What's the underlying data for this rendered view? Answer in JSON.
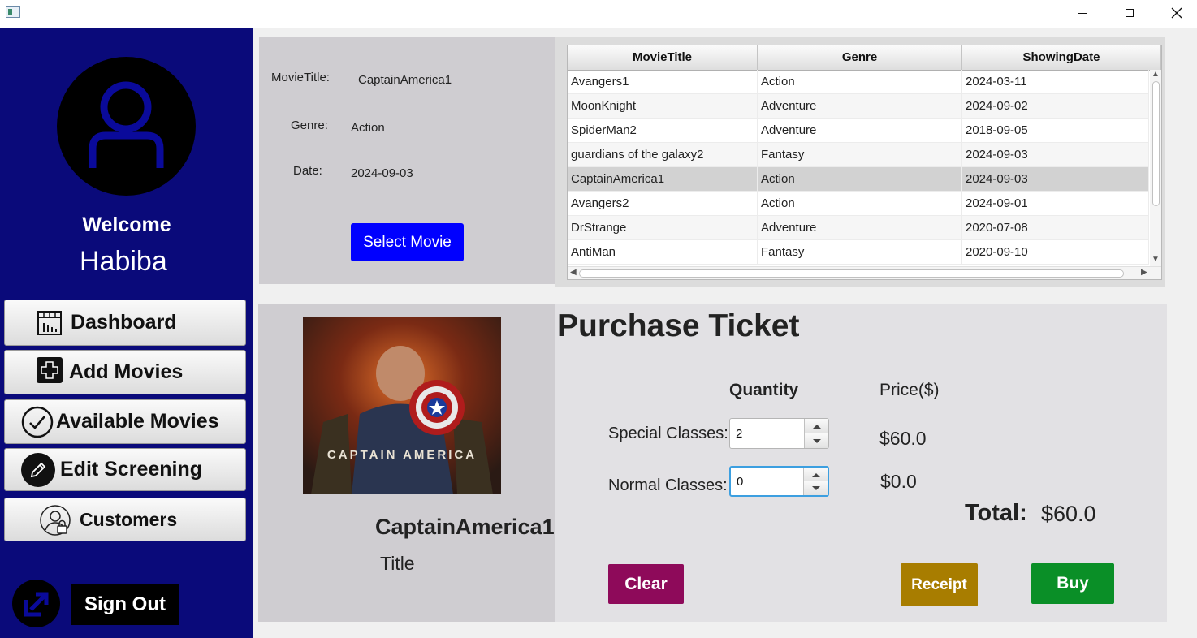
{
  "window": {
    "controls": {
      "minimize": "minimize",
      "maximize": "maximize",
      "close": "close"
    }
  },
  "sidebar": {
    "welcome": "Welcome",
    "username": "Habiba",
    "nav": [
      {
        "label": "Dashboard",
        "icon": "dashboard-icon"
      },
      {
        "label": "Add Movies",
        "icon": "add-icon"
      },
      {
        "label": "Available Movies",
        "icon": "check-icon"
      },
      {
        "label": "Edit Screening",
        "icon": "pencil-icon"
      },
      {
        "label": "Customers",
        "icon": "customers-icon"
      }
    ],
    "sign_out": "Sign Out"
  },
  "details": {
    "title_label": "MovieTitle:",
    "title_value": "CaptainAmerica1",
    "genre_label": "Genre:",
    "genre_value": "Action",
    "date_label": "Date:",
    "date_value": "2024-09-03",
    "select_button": "Select Movie"
  },
  "table": {
    "columns": [
      "MovieTitle",
      "Genre",
      "ShowingDate"
    ],
    "rows": [
      [
        "Avangers1",
        "Action",
        "2024-03-11"
      ],
      [
        "MoonKnight",
        "Adventure",
        "2024-09-02"
      ],
      [
        "SpiderMan2",
        "Adventure",
        "2018-09-05"
      ],
      [
        "guardians of the galaxy2",
        "Fantasy",
        "2024-09-03"
      ],
      [
        "CaptainAmerica1",
        "Action",
        "2024-09-03"
      ],
      [
        "Avangers2",
        "Action",
        "2024-09-01"
      ],
      [
        "DrStrange",
        "Adventure",
        "2020-07-08"
      ],
      [
        "AntiMan",
        "Fantasy",
        "2020-09-10"
      ]
    ],
    "selected_row": 4
  },
  "poster": {
    "title_text": "CAPTAIN AMERICA",
    "movie_name": "CaptainAmerica1",
    "caption": "Title"
  },
  "purchase": {
    "heading": "Purchase Ticket",
    "quantity_header": "Quantity",
    "price_header": "Price($)",
    "special_label": "Special Classes:",
    "special_qty": "2",
    "special_price": "$60.0",
    "normal_label": "Normal Classes:",
    "normal_qty": "0",
    "normal_price": "$0.0",
    "total_label": "Total:",
    "total_value": "$60.0",
    "clear_button": "Clear",
    "receipt_button": "Receipt",
    "buy_button": "Buy"
  },
  "colors": {
    "sidebar_bg": "#0a0a7a",
    "select_button": "#0000ff",
    "clear_button": "#8e0a5a",
    "receipt_button": "#a87d00",
    "buy_button": "#0a8f27"
  }
}
